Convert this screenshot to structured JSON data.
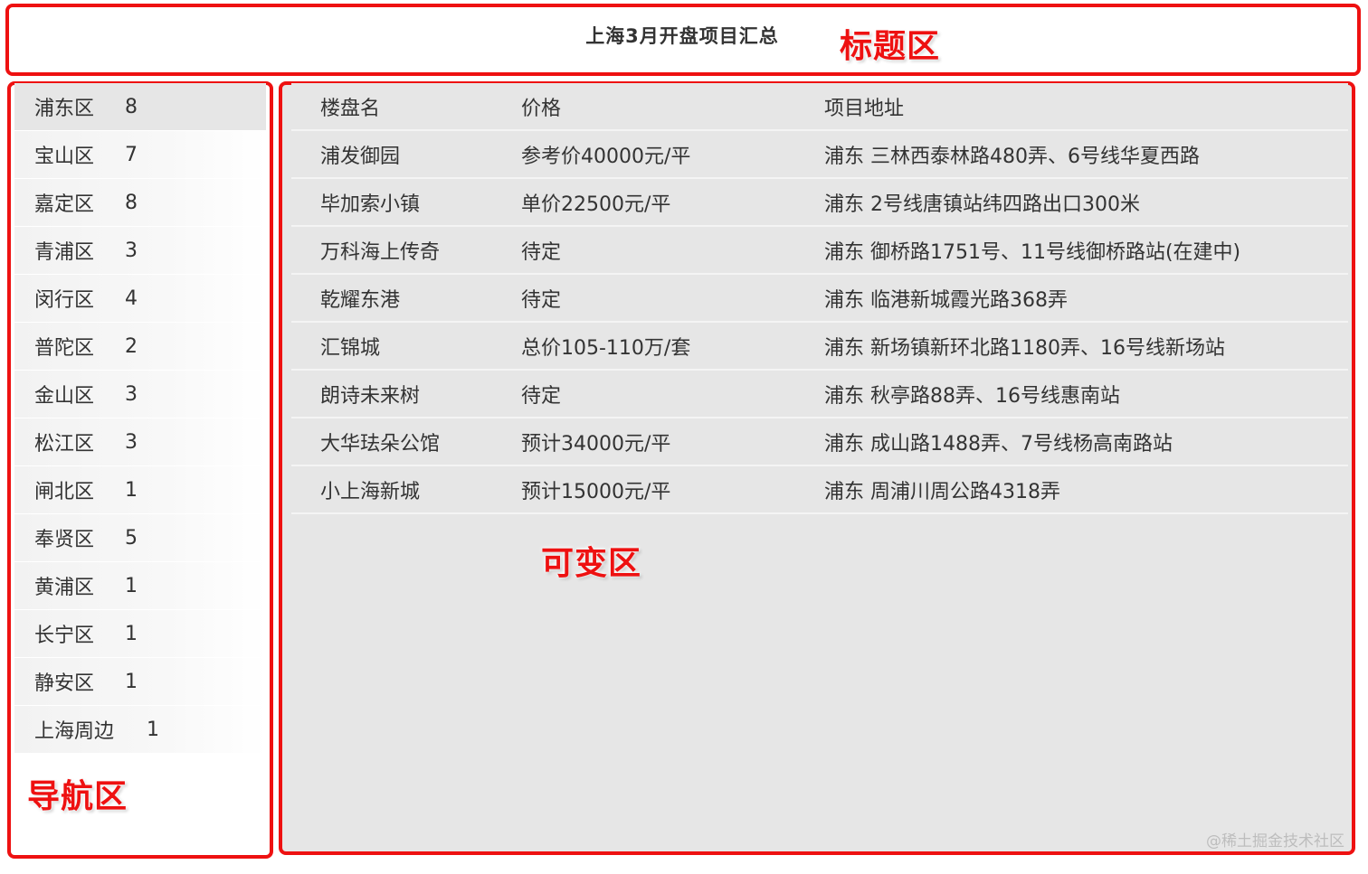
{
  "header": {
    "title": "上海3月开盘项目汇总"
  },
  "annotations": {
    "title_area": "标题区",
    "nav_area": "导航区",
    "main_area": "可变区"
  },
  "sidebar": {
    "items": [
      {
        "name": "浦东区",
        "count": "8"
      },
      {
        "name": "宝山区",
        "count": "7"
      },
      {
        "name": "嘉定区",
        "count": "8"
      },
      {
        "name": "青浦区",
        "count": "3"
      },
      {
        "name": "闵行区",
        "count": "4"
      },
      {
        "name": "普陀区",
        "count": "2"
      },
      {
        "name": "金山区",
        "count": "3"
      },
      {
        "name": "松江区",
        "count": "3"
      },
      {
        "name": "闸北区",
        "count": "1"
      },
      {
        "name": "奉贤区",
        "count": "5"
      },
      {
        "name": "黄浦区",
        "count": "1"
      },
      {
        "name": "长宁区",
        "count": "1"
      },
      {
        "name": "静安区",
        "count": "1"
      },
      {
        "name": "上海周边",
        "count": "1"
      }
    ]
  },
  "table": {
    "headers": [
      "楼盘名",
      "价格",
      "项目地址"
    ],
    "rows": [
      [
        "浦发御园",
        "参考价40000元/平",
        "浦东 三林西泰林路480弄、6号线华夏西路"
      ],
      [
        "毕加索小镇",
        "单价22500元/平",
        "浦东 2号线唐镇站纬四路出口300米"
      ],
      [
        "万科海上传奇",
        "待定",
        "浦东 御桥路1751号、11号线御桥路站(在建中)"
      ],
      [
        "乾耀东港",
        "待定",
        "浦东 临港新城霞光路368弄"
      ],
      [
        "汇锦城",
        "总价105-110万/套",
        "浦东 新场镇新环北路1180弄、16号线新场站"
      ],
      [
        "朗诗未来树",
        "待定",
        "浦东 秋亭路88弄、16号线惠南站"
      ],
      [
        "大华珐朵公馆",
        "预计34000元/平",
        "浦东 成山路1488弄、7号线杨高南路站"
      ],
      [
        "小上海新城",
        "预计15000元/平",
        "浦东 周浦川周公路4318弄"
      ]
    ]
  },
  "watermark": "@稀土掘金技术社区",
  "colors": {
    "annotation_red": "#ee1111",
    "main_bg": "#e6e6e6"
  }
}
